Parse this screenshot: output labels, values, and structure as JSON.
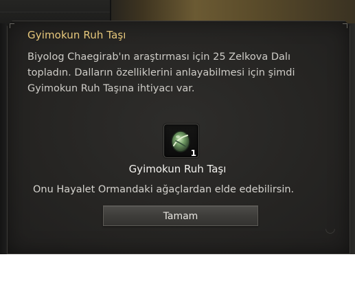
{
  "dialog": {
    "title": "Gyimokun Ruh Taşı",
    "body_line1": "Biyolog Chaegirab'ın araştırması için 25 Zelkova Dalı",
    "body_line2": "topladın. Dalların özelliklerini anlayabilmesi için şimdi",
    "body_line3": "Gyimokun Ruh Taşına ihtiyacı var.",
    "item": {
      "icon": "spirit-stone-icon",
      "count": "1",
      "name": "Gyimokun Ruh Taşı"
    },
    "hint": "Onu Hayalet Ormandaki ağaçlardan elde edebilirsin.",
    "confirm_label": "Tamam"
  },
  "colors": {
    "title": "#e8c97c",
    "text": "#cfcdc8",
    "panel": "#262523",
    "button": "#3e3d3a"
  }
}
